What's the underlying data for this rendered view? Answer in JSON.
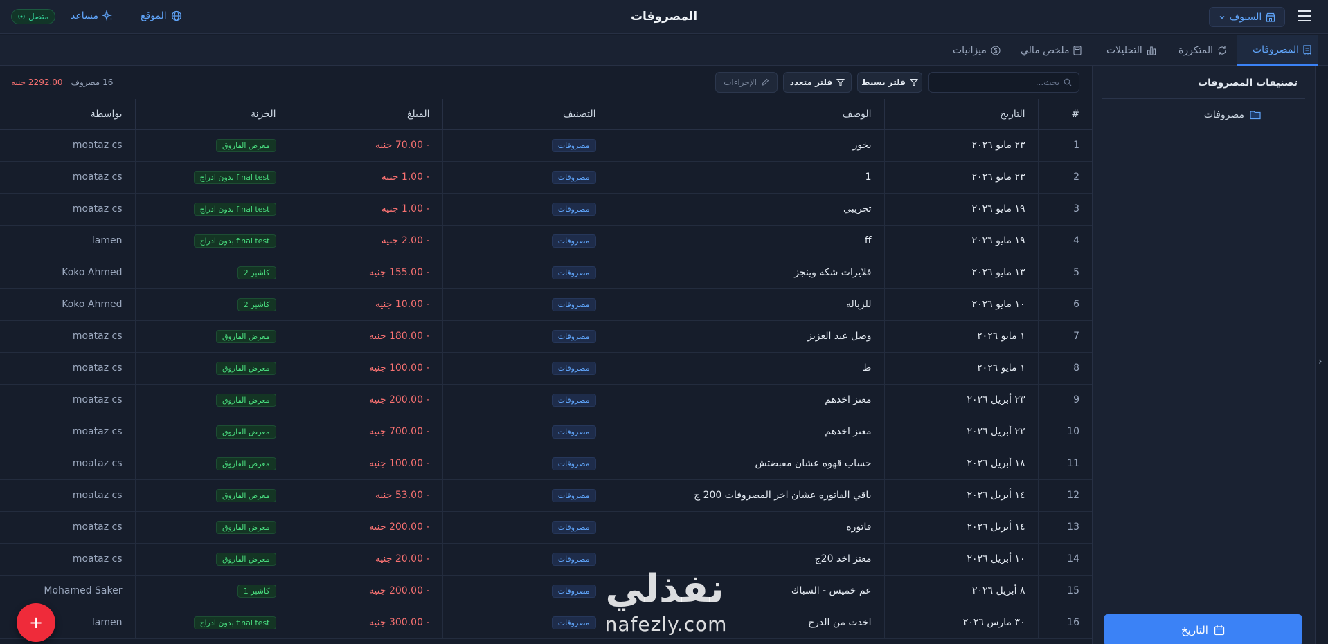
{
  "header": {
    "title": "المصروفات",
    "online": "متصل",
    "assistant": "مساعد",
    "site": "الموقع",
    "branch": "السيوف"
  },
  "tabs": [
    {
      "label": "المصروفات"
    },
    {
      "label": "المتكررة"
    },
    {
      "label": "التحليلات"
    },
    {
      "label": "ملخص مالي"
    },
    {
      "label": "ميزانيات"
    }
  ],
  "sidebar": {
    "title": "تصنيفات المصروفات",
    "item": "مصروفات",
    "date_button": "التاريخ"
  },
  "toolbar": {
    "search_placeholder": "بحث...",
    "simple_filter": "فلتر بسيط",
    "multi_filter": "فلتر متعدد",
    "actions": "الإجراءات",
    "count": "16 مصروف",
    "total": "2292.00 جنيه"
  },
  "table": {
    "headers": [
      "#",
      "التاريخ",
      "الوصف",
      "التصنيف",
      "المبلغ",
      "الخزنة",
      "بواسطة"
    ],
    "rows": [
      {
        "n": "1",
        "date": "٢٣ مايو ٢٠٢٦",
        "desc": "بخور",
        "cat": "مصروفات",
        "amount": "- 70.00 جنيه",
        "safe": "معرض الفاروق",
        "by": "moataz cs"
      },
      {
        "n": "2",
        "date": "٢٣ مايو ٢٠٢٦",
        "desc": "1",
        "cat": "مصروفات",
        "amount": "- 1.00 جنيه",
        "safe": "final test بدون ادراج",
        "by": "moataz cs"
      },
      {
        "n": "3",
        "date": "١٩ مايو ٢٠٢٦",
        "desc": "تجريبي",
        "cat": "مصروفات",
        "amount": "- 1.00 جنيه",
        "safe": "final test بدون ادراج",
        "by": "moataz cs"
      },
      {
        "n": "4",
        "date": "١٩ مايو ٢٠٢٦",
        "desc": "ff",
        "cat": "مصروفات",
        "amount": "- 2.00 جنيه",
        "safe": "final test بدون ادراج",
        "by": "lamen"
      },
      {
        "n": "5",
        "date": "١٣ مايو ٢٠٢٦",
        "desc": "فلايرات شكه وينجز",
        "cat": "مصروفات",
        "amount": "- 155.00 جنيه",
        "safe": "كاشير 2",
        "by": "Koko Ahmed"
      },
      {
        "n": "6",
        "date": "١٠ مايو ٢٠٢٦",
        "desc": "للزباله",
        "cat": "مصروفات",
        "amount": "- 10.00 جنيه",
        "safe": "كاشير 2",
        "by": "Koko Ahmed"
      },
      {
        "n": "7",
        "date": "١ مايو ٢٠٢٦",
        "desc": "وصل عبد العزيز",
        "cat": "مصروفات",
        "amount": "- 180.00 جنيه",
        "safe": "معرض الفاروق",
        "by": "moataz cs"
      },
      {
        "n": "8",
        "date": "١ مايو ٢٠٢٦",
        "desc": "ط",
        "cat": "مصروفات",
        "amount": "- 100.00 جنيه",
        "safe": "معرض الفاروق",
        "by": "moataz cs"
      },
      {
        "n": "9",
        "date": "٢٣ أبريل ٢٠٢٦",
        "desc": "معتز اخدهم",
        "cat": "مصروفات",
        "amount": "- 200.00 جنيه",
        "safe": "معرض الفاروق",
        "by": "moataz cs"
      },
      {
        "n": "10",
        "date": "٢٢ أبريل ٢٠٢٦",
        "desc": "معتز اخدهم",
        "cat": "مصروفات",
        "amount": "- 700.00 جنيه",
        "safe": "معرض الفاروق",
        "by": "moataz cs"
      },
      {
        "n": "11",
        "date": "١٨ أبريل ٢٠٢٦",
        "desc": "حساب قهوه عشان مقبضتش",
        "cat": "مصروفات",
        "amount": "- 100.00 جنيه",
        "safe": "معرض الفاروق",
        "by": "moataz cs"
      },
      {
        "n": "12",
        "date": "١٤ أبريل ٢٠٢٦",
        "desc": "باقي الفاتوره عشان اخر المصروفات 200 ج",
        "cat": "مصروفات",
        "amount": "- 53.00 جنيه",
        "safe": "معرض الفاروق",
        "by": "moataz cs"
      },
      {
        "n": "13",
        "date": "١٤ أبريل ٢٠٢٦",
        "desc": "فاتوره",
        "cat": "مصروفات",
        "amount": "- 200.00 جنيه",
        "safe": "معرض الفاروق",
        "by": "moataz cs"
      },
      {
        "n": "14",
        "date": "١٠ أبريل ٢٠٢٦",
        "desc": "معتز اخد 20ج",
        "cat": "مصروفات",
        "amount": "- 20.00 جنيه",
        "safe": "معرض الفاروق",
        "by": "moataz cs"
      },
      {
        "n": "15",
        "date": "٨ أبريل ٢٠٢٦",
        "desc": "عم خميس - السباك",
        "cat": "مصروفات",
        "amount": "- 200.00 جنيه",
        "safe": "كاشير 1",
        "by": "Mohamed Saker"
      },
      {
        "n": "16",
        "date": "٣٠ مارس ٢٠٢٦",
        "desc": "اخدت من الدرج",
        "cat": "مصروفات",
        "amount": "- 300.00 جنيه",
        "safe": "final test بدون ادراج",
        "by": "lamen"
      }
    ]
  },
  "fab": "+",
  "watermark": {
    "ar": "نفذلي",
    "en": "nafezly.com"
  },
  "icons": {
    "menu": "hamburger-icon",
    "branch": "store-icon",
    "site": "globe-icon",
    "assistant": "sparkles-icon",
    "online": "signal-icon"
  }
}
